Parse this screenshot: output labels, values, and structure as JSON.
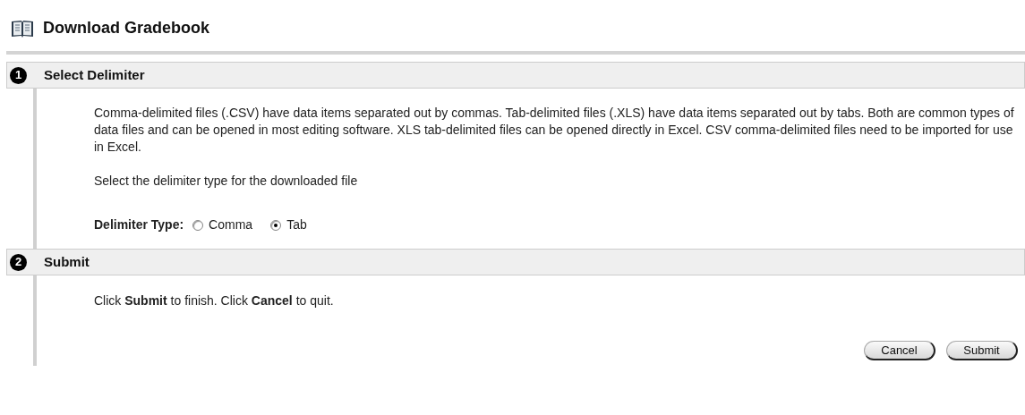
{
  "title": "Download Gradebook",
  "steps": [
    {
      "number": "1",
      "title": "Select Delimiter",
      "kind": "delimiter",
      "description": "Comma-delimited files (.CSV) have data items separated out by commas. Tab-delimited files (.XLS) have data items separated out by tabs. Both are common types of data files and can be opened in most editing software. XLS tab-delimited files can be opened directly in Excel. CSV comma-delimited files need to be imported for use in Excel.",
      "prompt": "Select the delimiter type for the downloaded file",
      "field_label": "Delimiter Type:",
      "options": [
        {
          "label": "Comma",
          "selected": false
        },
        {
          "label": "Tab",
          "selected": true
        }
      ]
    },
    {
      "number": "2",
      "title": "Submit",
      "kind": "submit",
      "instructions": "Click **Submit** to finish. Click **Cancel** to quit."
    }
  ],
  "buttons": [
    {
      "label": "Cancel"
    },
    {
      "label": "Submit"
    }
  ]
}
